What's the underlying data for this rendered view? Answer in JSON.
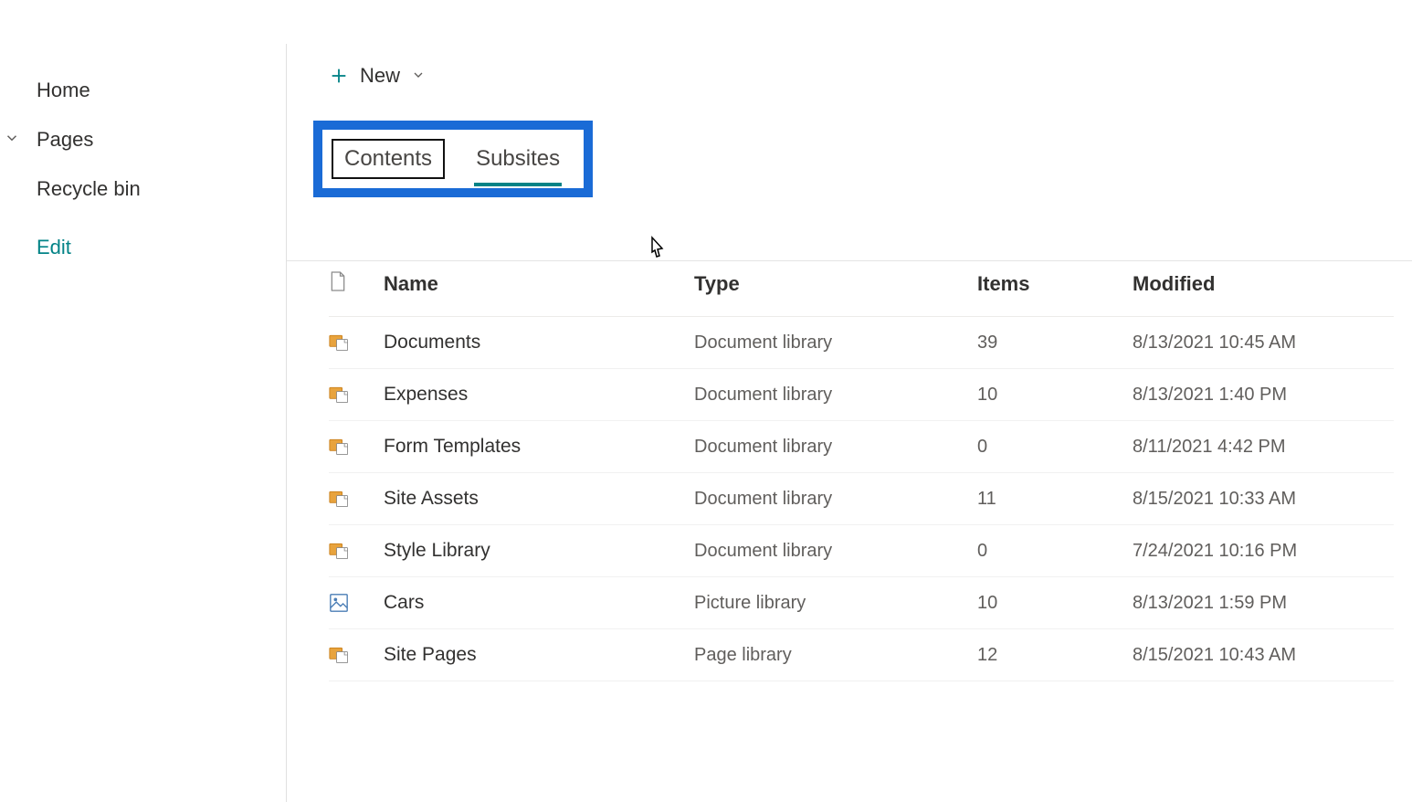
{
  "sidebar": {
    "items": [
      {
        "label": "Home"
      },
      {
        "label": "Pages"
      },
      {
        "label": "Recycle bin"
      }
    ],
    "edit_label": "Edit"
  },
  "toolbar": {
    "new_label": "New"
  },
  "tabs": {
    "contents_label": "Contents",
    "subsites_label": "Subsites"
  },
  "table": {
    "headers": {
      "name": "Name",
      "type": "Type",
      "items": "Items",
      "modified": "Modified"
    },
    "rows": [
      {
        "name": "Documents",
        "type": "Document library",
        "items": "39",
        "modified": "8/13/2021 10:45 AM",
        "kind": "doc"
      },
      {
        "name": "Expenses",
        "type": "Document library",
        "items": "10",
        "modified": "8/13/2021 1:40 PM",
        "kind": "doc"
      },
      {
        "name": "Form Templates",
        "type": "Document library",
        "items": "0",
        "modified": "8/11/2021 4:42 PM",
        "kind": "doc"
      },
      {
        "name": "Site Assets",
        "type": "Document library",
        "items": "11",
        "modified": "8/15/2021 10:33 AM",
        "kind": "doc"
      },
      {
        "name": "Style Library",
        "type": "Document library",
        "items": "0",
        "modified": "7/24/2021 10:16 PM",
        "kind": "doc"
      },
      {
        "name": "Cars",
        "type": "Picture library",
        "items": "10",
        "modified": "8/13/2021 1:59 PM",
        "kind": "pic"
      },
      {
        "name": "Site Pages",
        "type": "Page library",
        "items": "12",
        "modified": "8/15/2021 10:43 AM",
        "kind": "doc"
      }
    ]
  }
}
